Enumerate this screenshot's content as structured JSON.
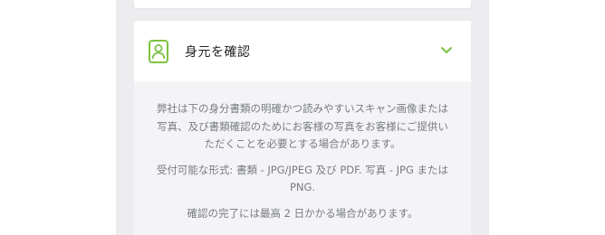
{
  "identity": {
    "title": "身元を確認",
    "paragraphs": [
      "弊社は下の身分書類の明確かつ読みやすいスキャン画像または写真、及び書類確認のためにお客様の写真をお客様にご提供いただくことを必要とする場合があります。",
      "受付可能な形式: 書類 - JPG/JPEG 及び PDF. 写真 - JPG または PNG.",
      "確認の完了には最高 2 日かかる場合があります。"
    ]
  },
  "colors": {
    "accent": "#7cc242",
    "body_text": "#777b80",
    "panel_bg": "#f4f4f6",
    "page_bg": "#ededef"
  },
  "icons": {
    "header": "id-card-icon",
    "toggle": "chevron-down-icon"
  }
}
